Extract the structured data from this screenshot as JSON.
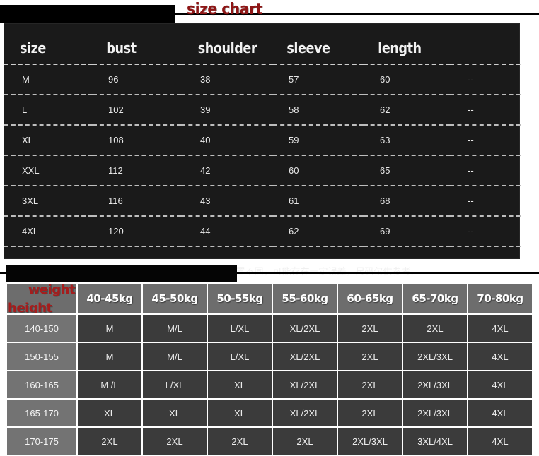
{
  "section1": {
    "title": "size chart",
    "table": {
      "headers": [
        "size",
        "bust",
        "shoulder",
        "sleeve",
        "length",
        ""
      ],
      "rows": [
        [
          "M",
          "96",
          "38",
          "57",
          "60",
          "--"
        ],
        [
          "L",
          "102",
          "39",
          "58",
          "62",
          "--"
        ],
        [
          "XL",
          "108",
          "40",
          "59",
          "63",
          "--"
        ],
        [
          "XXL",
          "112",
          "42",
          "60",
          "65",
          "--"
        ],
        [
          "3XL",
          "116",
          "43",
          "61",
          "68",
          "--"
        ],
        [
          "4XL",
          "120",
          "44",
          "62",
          "69",
          "--"
        ]
      ]
    },
    "note": "*商品尺寸为人工平铺测量，因个人测量手法差异或位置不同，可能存在一定误差，尺码仅供参考."
  },
  "section2": {
    "corner": {
      "weight_label": "weight",
      "height_label": "height"
    },
    "weight_headers": [
      "40-45kg",
      "45-50kg",
      "50-55kg",
      "55-60kg",
      "60-65kg",
      "65-70kg",
      "70-80kg"
    ],
    "height_labels": [
      "140-150",
      "150-155",
      "160-165",
      "165-170",
      "170-175"
    ],
    "rows": [
      [
        "M",
        "M/L",
        "L/XL",
        "XL/2XL",
        "2XL",
        "2XL",
        "4XL"
      ],
      [
        "M",
        "M/L",
        "L/XL",
        "XL/2XL",
        "2XL",
        "2XL/3XL",
        "4XL"
      ],
      [
        "M /L",
        "L/XL",
        "XL",
        "XL/2XL",
        "2XL",
        "2XL/3XL",
        "4XL"
      ],
      [
        "XL",
        "XL",
        "XL",
        "XL/2XL",
        "2XL",
        "2XL/3XL",
        "4XL"
      ],
      [
        "2XL",
        "2XL",
        "2XL",
        "2XL",
        "2XL/3XL",
        "3XL/4XL",
        "4XL"
      ]
    ]
  },
  "colors": {
    "title_red": "#8e1616",
    "label_red": "#a61c1c",
    "panel_dark": "#1a1a1a",
    "header_gray": "#6d6d6d",
    "cell_dark": "#3b3b3b"
  }
}
